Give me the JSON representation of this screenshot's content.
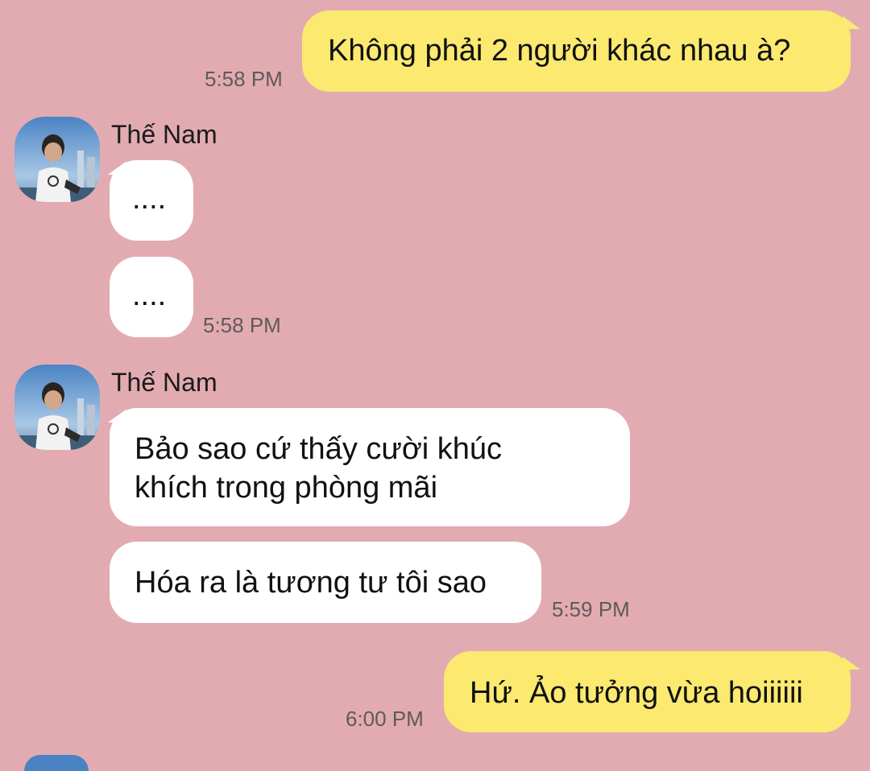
{
  "chat": {
    "contact_name": "Thế Nam",
    "colors": {
      "background": "#e2abb2",
      "outgoing_bubble": "#fbe970",
      "incoming_bubble": "#ffffff",
      "timestamp": "#5f5a5b"
    },
    "messages": [
      {
        "direction": "outgoing",
        "text": "Không phải 2 người khác nhau à?",
        "time": "5:58 PM"
      },
      {
        "direction": "incoming",
        "sender": "Thế Nam",
        "text": "....",
        "time": ""
      },
      {
        "direction": "incoming",
        "text": "....",
        "time": "5:58 PM"
      },
      {
        "direction": "incoming",
        "sender": "Thế Nam",
        "line1": "Bảo sao cứ thấy cười khúc",
        "line2": "khích trong phòng mãi",
        "time": ""
      },
      {
        "direction": "incoming",
        "text": "Hóa ra là tương tư tôi sao",
        "time": "5:59 PM"
      },
      {
        "direction": "outgoing",
        "text": "Hứ. Ảo tưởng vừa hoiiiiii",
        "time": "6:00 PM"
      }
    ]
  },
  "icons": {
    "avatar": "profile-photo-avatar"
  }
}
